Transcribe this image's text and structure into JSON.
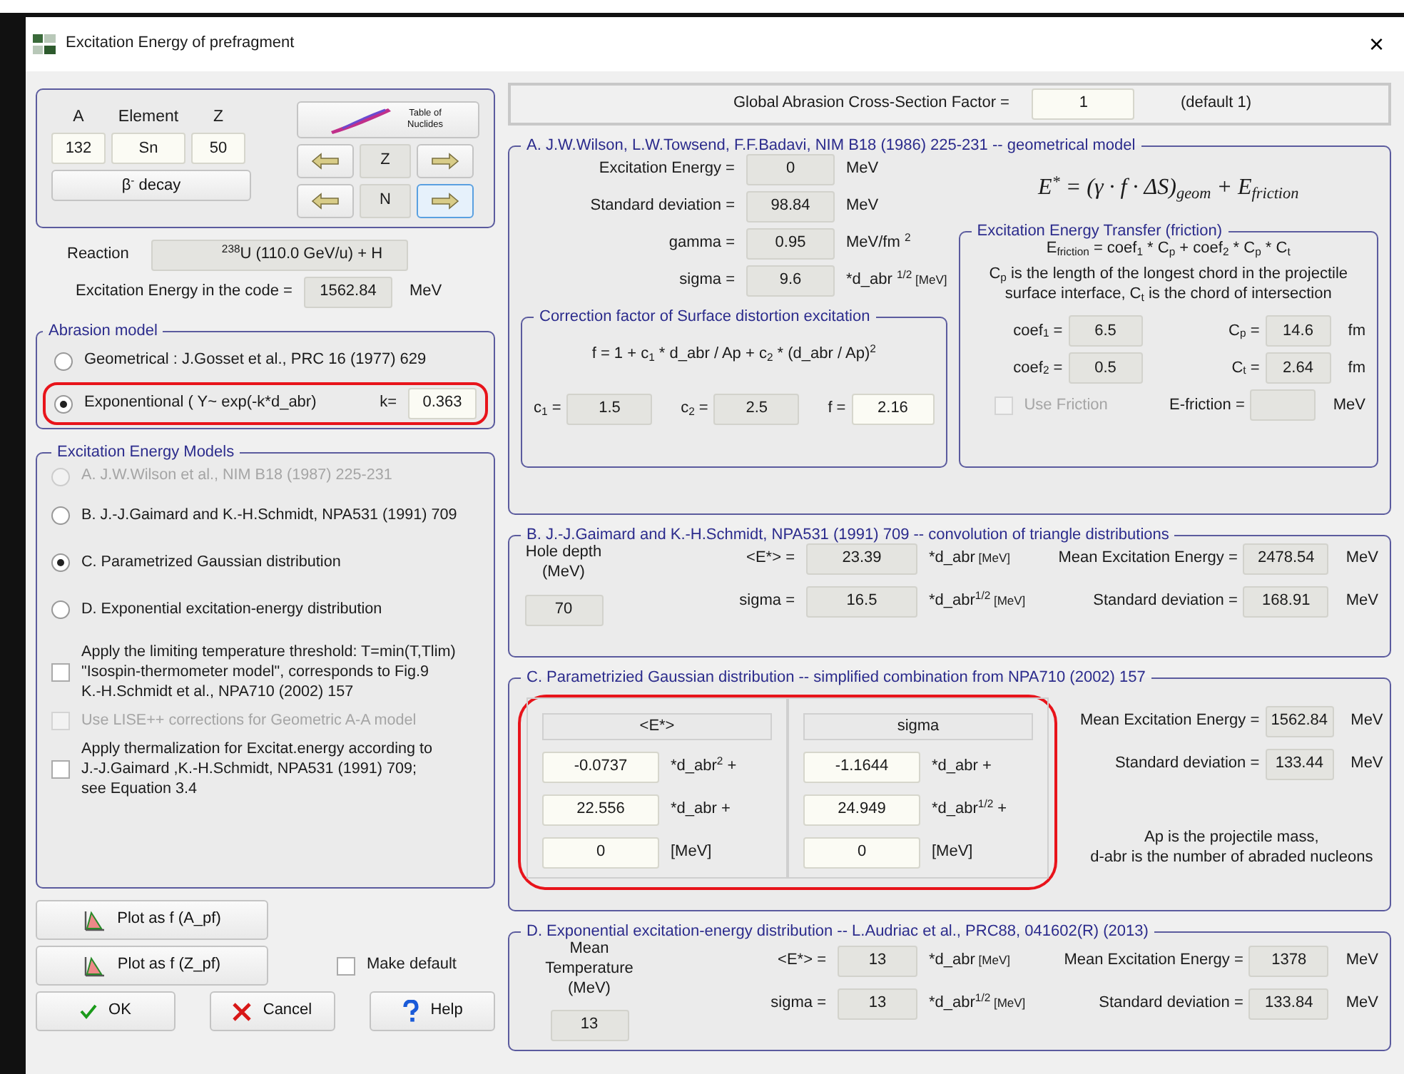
{
  "window": {
    "title": "Excitation Energy of prefragment",
    "close": "×"
  },
  "nuclide": {
    "labels": [
      "A",
      "Element",
      "Z"
    ],
    "values": [
      "132",
      "Sn",
      "50"
    ],
    "decay": [
      {
        "text": "β"
      },
      {
        "sup": "-"
      },
      {
        "text": "  decay"
      }
    ],
    "table_button": "Table of Nuclides",
    "steppers": [
      {
        "label": "Z",
        "right_focused": false
      },
      {
        "label": "N",
        "right_focused": true
      }
    ]
  },
  "reaction": {
    "label": "Reaction",
    "value": [
      {
        "sup": "238"
      },
      {
        "text": "U (110.0 GeV/u) + H"
      }
    ]
  },
  "code_energy": {
    "label": "Excitation Energy in the code =",
    "value": "1562.84",
    "unit": "MeV"
  },
  "abrasion_model": {
    "title": "Abrasion model",
    "options": [
      {
        "label": "Geometrical :  J.Gosset et al., PRC 16 (1977) 629",
        "selected": false,
        "highlighted": false
      },
      {
        "label": "Exponentional ( Y~ exp(-k*d_abr)",
        "selected": true,
        "highlighted": true,
        "param": {
          "label": "k=",
          "value": "0.363"
        }
      }
    ]
  },
  "models": {
    "title": "Excitation Energy Models",
    "options": [
      {
        "label": "A.  J.W.Wilson et al., NIM B18 (1987) 225-231",
        "selected": false,
        "disabled": true
      },
      {
        "label": "B.  J.-J.Gaimard and K.-H.Schmidt, NPA531 (1991) 709",
        "selected": false,
        "disabled": false
      },
      {
        "label": "C.  Parametrized Gaussian distribution",
        "selected": true,
        "disabled": false
      },
      {
        "label": "D.  Exponential excitation-energy distribution",
        "selected": false,
        "disabled": false
      }
    ],
    "checkboxes": [
      {
        "lines": [
          "Apply the limiting temperature threshold: T=min(T,Tlim)",
          "\"Isospin-thermometer model\",  corresponds to Fig.9",
          "K.-H.Schmidt et al., NPA710 (2002) 157"
        ],
        "checked": false,
        "disabled": false
      },
      {
        "lines": [
          "Use LISE++ corrections for Geometric A-A model"
        ],
        "checked": false,
        "disabled": true
      },
      {
        "lines": [
          "Apply thermalization for Excitat.energy according to",
          "J.-J.Gaimard ,K.-H.Schmidt, NPA531 (1991) 709;",
          "see Equation 3.4"
        ],
        "checked": false,
        "disabled": false
      }
    ]
  },
  "plot_buttons": [
    "Plot as f (A_pf)",
    "Plot as f (Z_pf)"
  ],
  "make_default": {
    "label": "Make default",
    "checked": false
  },
  "buttons": [
    {
      "kind": "ok",
      "label": "OK"
    },
    {
      "kind": "cancel",
      "label": "Cancel"
    },
    {
      "kind": "help",
      "label": "Help"
    }
  ],
  "global_factor": {
    "label": "Global Abrasion Cross-Section Factor =",
    "value": "1",
    "note": "(default 1)"
  },
  "section_a": {
    "title": "A.   J.W.Wilson,  L.W.Towsend, F.F.Badavi, NIM B18 (1986) 225-231 -- geometrical model",
    "fields": [
      {
        "label": "Excitation Energy =",
        "value": "0",
        "unit": [
          {
            "text": "MeV"
          }
        ]
      },
      {
        "label": "Standard deviation =",
        "value": "98.84",
        "unit": [
          {
            "text": "MeV"
          }
        ]
      },
      {
        "label": "gamma =",
        "value": "0.95",
        "unit": [
          {
            "text": "MeV/fm "
          },
          {
            "sup": "2"
          }
        ]
      },
      {
        "label": "sigma =",
        "value": "9.6",
        "unit": [
          {
            "text": "*d_abr "
          },
          {
            "sup": "1/2"
          },
          {
            "small": " [MeV]"
          }
        ]
      }
    ],
    "formula": [
      {
        "text": "E"
      },
      {
        "sup": "*"
      },
      {
        "text": " = (γ · f · ΔS)"
      },
      {
        "sub": "geom"
      },
      {
        "text": " + E"
      },
      {
        "sub": "friction"
      }
    ],
    "correction": {
      "title": "Correction factor of Surface distortion excitation",
      "formula": [
        {
          "text": "f = 1 + c"
        },
        {
          "sub": "1"
        },
        {
          "text": " * d_abr / Ap + c"
        },
        {
          "sub": "2"
        },
        {
          "text": " * (d_abr / Ap)"
        },
        {
          "sup": "2"
        }
      ],
      "fields": [
        {
          "label": [
            {
              "text": "c"
            },
            {
              "sub": "1"
            },
            {
              "text": " ="
            }
          ],
          "value": "1.5"
        },
        {
          "label": [
            {
              "text": "c"
            },
            {
              "sub": "2"
            },
            {
              "text": " ="
            }
          ],
          "value": "2.5"
        },
        {
          "label": [
            {
              "text": "f ="
            }
          ],
          "value": "2.16"
        }
      ]
    },
    "friction": {
      "title": "Excitation Energy Transfer (friction)",
      "formula": [
        {
          "text": "E"
        },
        {
          "sub": "friction"
        },
        {
          "text": " = coef"
        },
        {
          "sub": "1"
        },
        {
          "text": " * C"
        },
        {
          "sub": "p"
        },
        {
          "text": " + coef"
        },
        {
          "sub": "2"
        },
        {
          "text": " * C"
        },
        {
          "sub": "p"
        },
        {
          "text": " * C"
        },
        {
          "sub": "t"
        }
      ],
      "description": [
        {
          "text": "C"
        },
        {
          "sub": "p"
        },
        {
          "text": " is the length of the longest chord in the projectile surface interface, C"
        },
        {
          "sub": "t"
        },
        {
          "text": " is the chord of intersection"
        }
      ],
      "coefs": [
        {
          "label": [
            {
              "text": "coef"
            },
            {
              "sub": "1"
            },
            {
              "text": " ="
            }
          ],
          "value": "6.5"
        },
        {
          "label": [
            {
              "text": "coef"
            },
            {
              "sub": "2"
            },
            {
              "text": " ="
            }
          ],
          "value": "0.5"
        }
      ],
      "chords": [
        {
          "label": [
            {
              "text": "C"
            },
            {
              "sub": "p"
            },
            {
              "text": " ="
            }
          ],
          "value": "14.6",
          "unit": "fm"
        },
        {
          "label": [
            {
              "text": "C"
            },
            {
              "sub": "t"
            },
            {
              "text": " ="
            }
          ],
          "value": "2.64",
          "unit": "fm"
        }
      ],
      "use_friction": {
        "label": "Use Friction",
        "checked": false,
        "disabled": true
      },
      "e_friction": {
        "label": "E-friction =",
        "unit": "MeV"
      }
    }
  },
  "section_b": {
    "title": "B.  J.-J.Gaimard and K.-H.Schmidt, NPA531 (1991) 709 -- convolution of triangle distributions",
    "param": {
      "label": "Hole depth (MeV)",
      "value": "70"
    },
    "fields": [
      {
        "label": "<E*> =",
        "value": "23.39",
        "unit": [
          {
            "text": "*d_abr"
          },
          {
            "small": " [MeV]"
          }
        ]
      },
      {
        "label": "sigma =",
        "value": "16.5",
        "unit": [
          {
            "text": "*d_abr"
          },
          {
            "sup": "1/2"
          },
          {
            "small": " [MeV]"
          }
        ]
      }
    ],
    "results": [
      {
        "label": "Mean Excitation Energy =",
        "value": "2478.54",
        "unit": "MeV"
      },
      {
        "label": "Standard deviation =",
        "value": "168.91",
        "unit": "MeV"
      }
    ]
  },
  "section_c": {
    "title": "C.  Parametrizied Gaussian distribution -- simplified combination from NPA710 (2002) 157",
    "highlighted": true,
    "columns": [
      {
        "header": "<E*>",
        "rows": [
          {
            "value": "-0.0737",
            "unit": [
              {
                "text": "*d_abr"
              },
              {
                "sup": "2"
              },
              {
                "text": " +"
              }
            ]
          },
          {
            "value": "22.556",
            "unit": [
              {
                "text": "*d_abr +"
              }
            ]
          },
          {
            "value": "0",
            "unit": [
              {
                "text": "[MeV]"
              }
            ]
          }
        ]
      },
      {
        "header": "sigma",
        "rows": [
          {
            "value": "-1.1644",
            "unit": [
              {
                "text": "*d_abr +"
              }
            ]
          },
          {
            "value": "24.949",
            "unit": [
              {
                "text": "*d_abr"
              },
              {
                "sup": "1/2"
              },
              {
                "text": " +"
              }
            ]
          },
          {
            "value": "0",
            "unit": [
              {
                "text": "[MeV]"
              }
            ]
          }
        ]
      }
    ],
    "results": [
      {
        "label": "Mean Excitation Energy =",
        "value": "1562.84",
        "unit": "MeV"
      },
      {
        "label": "Standard deviation =",
        "value": "133.44",
        "unit": "MeV"
      }
    ],
    "note": [
      "Ap is the projectile mass,",
      "d-abr is the number of abraded nucleons"
    ]
  },
  "section_d": {
    "title": "D.  Exponential excitation-energy distribution -- L.Audriac et al., PRC88, 041602(R) (2013)",
    "param": {
      "label": "Mean Temperature (MeV)",
      "value": "13"
    },
    "fields": [
      {
        "label": "<E*> =",
        "value": "13",
        "unit": [
          {
            "text": "*d_abr"
          },
          {
            "small": " [MeV]"
          }
        ]
      },
      {
        "label": "sigma =",
        "value": "13",
        "unit": [
          {
            "text": "*d_abr"
          },
          {
            "sup": "1/2"
          },
          {
            "small": " [MeV]"
          }
        ]
      }
    ],
    "results": [
      {
        "label": "Mean Excitation Energy =",
        "value": "1378",
        "unit": "MeV"
      },
      {
        "label": "Standard deviation =",
        "value": "133.84",
        "unit": "MeV"
      }
    ]
  }
}
